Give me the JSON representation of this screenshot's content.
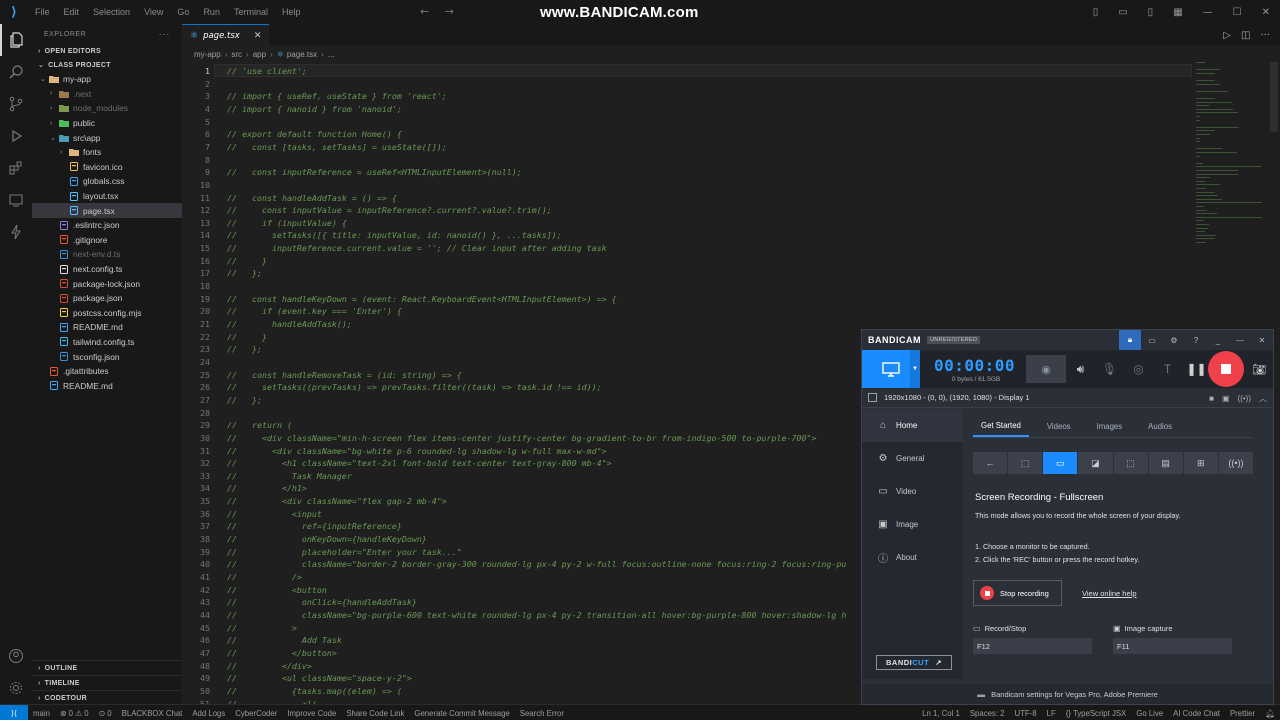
{
  "titlebar": {
    "menu": [
      "File",
      "Edit",
      "Selection",
      "View",
      "Go",
      "Run",
      "Terminal",
      "Help"
    ],
    "watermark": "www.BANDICAM.com"
  },
  "explorer": {
    "header": "EXPLORER",
    "open_editors": "OPEN EDITORS",
    "project": "CLASS PROJECT",
    "tree": [
      {
        "label": "my-app",
        "depth": 1,
        "kind": "folder-open",
        "color": "#dcb67a"
      },
      {
        "label": ".next",
        "depth": 2,
        "kind": "folder",
        "color": "#9a7a4d",
        "dim": true
      },
      {
        "label": "node_modules",
        "depth": 2,
        "kind": "folder",
        "color": "#7a9a4d",
        "dim": true
      },
      {
        "label": "public",
        "depth": 2,
        "kind": "folder",
        "color": "#4dbb5a"
      },
      {
        "label": "src\\app",
        "depth": 2,
        "kind": "folder-open",
        "color": "#4d9ab3"
      },
      {
        "label": "fonts",
        "depth": 3,
        "kind": "folder",
        "color": "#dcb67a"
      },
      {
        "label": "favicon.ico",
        "depth": 3,
        "kind": "file",
        "color": "#f0c24e"
      },
      {
        "label": "globals.css",
        "depth": 3,
        "kind": "file",
        "color": "#42a5f5"
      },
      {
        "label": "layout.tsx",
        "depth": 3,
        "kind": "file",
        "color": "#4fc1ff"
      },
      {
        "label": "page.tsx",
        "depth": 3,
        "kind": "file",
        "color": "#4fc1ff",
        "selected": true
      },
      {
        "label": ".eslintrc.json",
        "depth": 2,
        "kind": "file",
        "color": "#8f7ae5"
      },
      {
        "label": ".gitignore",
        "depth": 2,
        "kind": "file",
        "color": "#e65b3c"
      },
      {
        "label": "next-env.d.ts",
        "depth": 2,
        "kind": "file",
        "color": "#3b8fd6",
        "dim": true
      },
      {
        "label": "next.config.ts",
        "depth": 2,
        "kind": "file",
        "color": "#e0e0e0"
      },
      {
        "label": "package-lock.json",
        "depth": 2,
        "kind": "file",
        "color": "#d44a3a"
      },
      {
        "label": "package.json",
        "depth": 2,
        "kind": "file",
        "color": "#d44a3a"
      },
      {
        "label": "postcss.config.mjs",
        "depth": 2,
        "kind": "file",
        "color": "#f0d44e"
      },
      {
        "label": "README.md",
        "depth": 2,
        "kind": "file",
        "color": "#42a5f5"
      },
      {
        "label": "tailwind.config.ts",
        "depth": 2,
        "kind": "file",
        "color": "#38bdf8"
      },
      {
        "label": "tsconfig.json",
        "depth": 2,
        "kind": "file",
        "color": "#3b8fd6"
      },
      {
        "label": ".gitattributes",
        "depth": 1,
        "kind": "file",
        "color": "#e65b3c"
      },
      {
        "label": "README.md",
        "depth": 1,
        "kind": "file",
        "color": "#42a5f5"
      }
    ],
    "bottom_sections": [
      "OUTLINE",
      "TIMELINE",
      "CODETOUR"
    ]
  },
  "editor": {
    "tab": "page.tsx",
    "breadcrumb": [
      "my-app",
      "src",
      "app",
      "page.tsx",
      "..."
    ],
    "lines": [
      "// 'use client';",
      "",
      "// import { useRef, useState } from 'react';",
      "// import { nanoid } from 'nanoid';",
      "",
      "// export default function Home() {",
      "//   const [tasks, setTasks] = useState([]);",
      "",
      "//   const inputReference = useRef<HTMLInputElement>(null);",
      "",
      "//   const handleAddTask = () => {",
      "//     const inputValue = inputReference?.current?.value?.trim();",
      "//     if (inputValue) {",
      "//       setTasks([{ title: inputValue, id: nanoid() }, ...tasks]);",
      "//       inputReference.current.value = ''; // Clear input after adding task",
      "//     }",
      "//   };",
      "",
      "//   const handleKeyDown = (event: React.KeyboardEvent<HTMLInputElement>) => {",
      "//     if (event.key === 'Enter') {",
      "//       handleAddTask();",
      "//     }",
      "//   };",
      "",
      "//   const handleRemoveTask = (id: string) => {",
      "//     setTasks((prevTasks) => prevTasks.filter((task) => task.id !== id));",
      "//   };",
      "",
      "//   return (",
      "//     <div className=\"min-h-screen flex items-center justify-center bg-gradient-to-br from-indigo-500 to-purple-700\">",
      "//       <div className=\"bg-white p-6 rounded-lg shadow-lg w-full max-w-md\">",
      "//         <h1 className=\"text-2xl font-bold text-center text-gray-800 mb-4\">",
      "//           Task Manager",
      "//         </h1>",
      "//         <div className=\"flex gap-2 mb-4\">",
      "//           <input",
      "//             ref={inputReference}",
      "//             onKeyDown={handleKeyDown}",
      "//             placeholder=\"Enter your task...\"",
      "//             className=\"border-2 border-gray-300 rounded-lg px-4 py-2 w-full focus:outline-none focus:ring-2 focus:ring-pu",
      "//           />",
      "//           <button",
      "//             onClick={handleAddTask}",
      "//             className=\"bg-purple-600 text-white rounded-lg px-4 py-2 transition-all hover:bg-purple-800 hover:shadow-lg h",
      "//           >",
      "//             Add Task",
      "//           </button>",
      "//         </div>",
      "//         <ul className=\"space-y-2\">",
      "//           {tasks.map((elem) => (",
      "//             <li"
    ]
  },
  "statusbar": {
    "left": [
      "main",
      "⊗ 0 ⚠ 0",
      "⊙ 0",
      "BLACKBOX Chat",
      "Add Logs",
      "CyberCoder",
      "Improve Code",
      "Share Code Link",
      "Generate Commit Message",
      "Search Error"
    ],
    "right": [
      "Ln 1, Col 1",
      "Spaces: 2",
      "UTF-8",
      "LF",
      "{} TypeScript JSX",
      "Go Live",
      "AI Code Chat",
      "Prettier"
    ]
  },
  "bandicam": {
    "logo": "BANDICAM",
    "unregistered": "UNREGISTERED",
    "timer": "00:00:00",
    "size": "0 bytes / 61.5GB",
    "target": "1920x1080 - (0, 0), (1920, 1080) - Display 1",
    "nav": [
      {
        "label": "Home",
        "icon": "home-icon",
        "glyph": "⌂",
        "active": true
      },
      {
        "label": "General",
        "icon": "gear-icon",
        "glyph": "⚙",
        "active": false
      },
      {
        "label": "Video",
        "icon": "video-icon",
        "glyph": "▭",
        "active": false
      },
      {
        "label": "Image",
        "icon": "image-icon",
        "glyph": "▣",
        "active": false
      },
      {
        "label": "About",
        "icon": "info-icon",
        "glyph": "ⓘ",
        "active": false
      }
    ],
    "bandicut_prefix": "BANDI",
    "bandicut_suffix": "CUT",
    "bandicut_arrow": "↗",
    "tabs": [
      "Get Started",
      "Videos",
      "Images",
      "Audios"
    ],
    "heading": "Screen Recording - Fullscreen",
    "description": "This mode allows you to record the whole screen of your display.",
    "steps": [
      "1. Choose a monitor to be captured.",
      "2. Click the 'REC' button or press the record hotkey."
    ],
    "stop_label": "Stop recording",
    "help_label": "View online help",
    "hotkey_record_label": "Record/Stop",
    "hotkey_record_value": "F12",
    "hotkey_image_label": "Image capture",
    "hotkey_image_value": "F11",
    "footer": "Bandicam settings for Vegas Pro, Adobe Premiere"
  }
}
